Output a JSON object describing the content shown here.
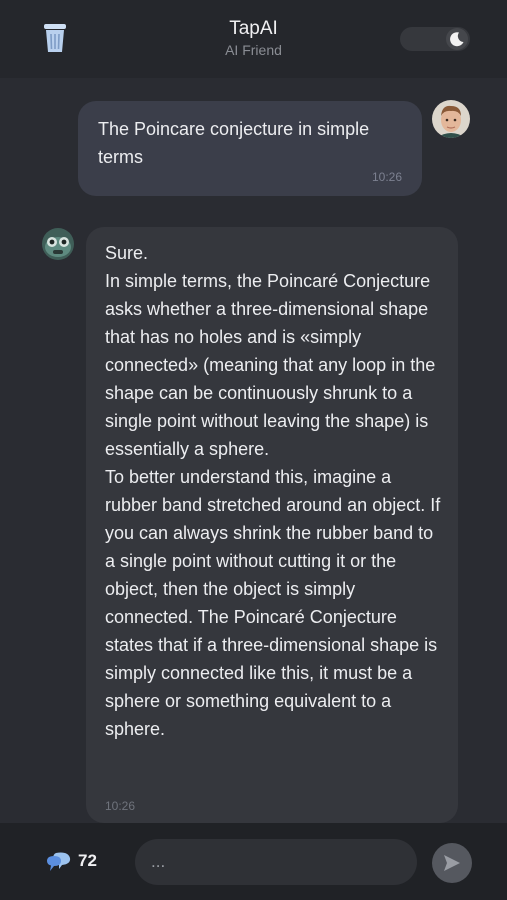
{
  "header": {
    "title": "TapAI",
    "subtitle": "AI Friend",
    "trash_icon": "trash-can-icon",
    "theme_toggle_icon": "moon-icon"
  },
  "messages": [
    {
      "role": "user",
      "text": "The Poincare conjecture in simple terms",
      "time": "10:26"
    },
    {
      "role": "assistant",
      "paragraphs": [
        "Sure.",
        "In simple terms, the Poincaré Conjecture asks whether a three-dimensional shape that has no holes and is «simply connected» (meaning that any loop in the shape can be continuously shrunk to a single point without leaving the shape) is essentially a sphere.",
        "To better understand this, imagine a rubber band stretched around an object. If you can always shrink the rubber band to a single point without cutting it or the object, then the object is simply connected. The Poincaré Conjecture states that if a three-dimensional shape is simply connected like this, it must be a sphere or something equivalent to a sphere."
      ],
      "time": "10:26"
    }
  ],
  "footer": {
    "coins_icon": "chat-bubbles-icon",
    "coins_count": "72",
    "input_placeholder": "...",
    "send_icon": "send-arrow-icon"
  },
  "colors": {
    "background": "#2a2c32",
    "user_bubble": "#3b3e4a",
    "assistant_bubble": "#35373d",
    "accent": "#5b8fe0"
  }
}
